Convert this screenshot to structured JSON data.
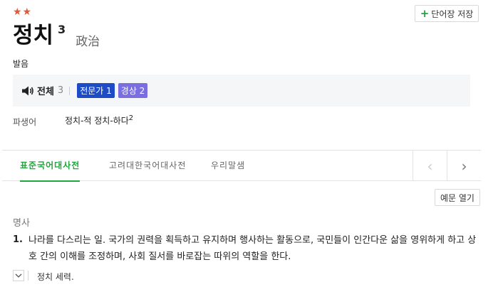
{
  "entry": {
    "stars": "★★",
    "word": "정치",
    "homonym_number": "3",
    "hanja": "政治"
  },
  "toolbar": {
    "save_label": "단어장 저장"
  },
  "pronunciation": {
    "label": "발음",
    "all_label": "전체",
    "all_count": "3",
    "badges": [
      {
        "label": "전문가 1",
        "color": "#1e4bc6"
      },
      {
        "label": "경상 2",
        "color": "#7a6ee0"
      }
    ]
  },
  "derivative": {
    "label": "파생어",
    "value": "정치-적 정치-하다",
    "value_sup": "2"
  },
  "tabs": [
    {
      "label": "표준국어대사전",
      "active": true
    },
    {
      "label": "고려대한국어대사전",
      "active": false
    },
    {
      "label": "우리말샘",
      "active": false
    }
  ],
  "nav": {
    "prev_icon": "‹",
    "next_icon": "›"
  },
  "example_toggle_label": "예문 열기",
  "definition": {
    "pos": "명사",
    "number": "1.",
    "text": "나라를 다스리는 일. 국가의 권력을 획득하고 유지하며 행사하는 활동으로, 국민들이 인간다운 삶을 영위하게 하고 상호 간의 이해를 조정하며, 사회 질서를 바로잡는 따위의 역할을 한다.",
    "example": "정치 세력."
  },
  "colors": {
    "accent_green": "#1fa63c",
    "star_red": "#e05a3a"
  }
}
